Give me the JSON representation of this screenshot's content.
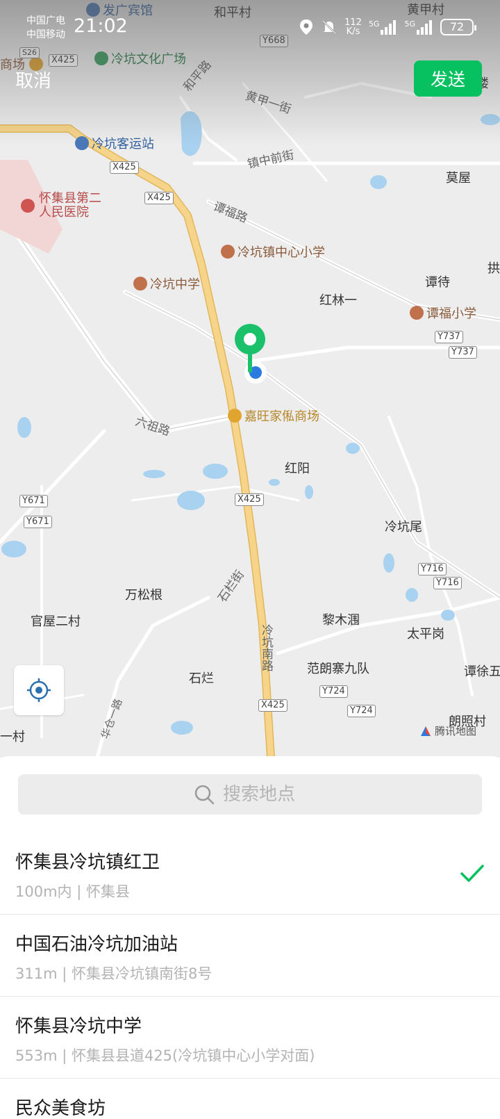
{
  "status_bar": {
    "carrier_line1": "中国广电",
    "carrier_line2": "中国移动",
    "time": "21:02",
    "net_speed_value": "112",
    "net_speed_unit": "K/s",
    "signal1_label": "5G",
    "signal2_label": "5G",
    "battery": "72"
  },
  "header": {
    "cancel_label": "取消",
    "send_label": "发送"
  },
  "map": {
    "provider": "腾讯地图",
    "labels": {
      "fa_guang_hotel": "发广宾馆",
      "he_ping_cun": "和平村",
      "huang_jia_cun": "黄甲村",
      "shang_chang": "商场",
      "leng_keng_culture_square": "冷坑文化广场",
      "lou": "楼",
      "he_ping_lu": "和平路",
      "huang_jia_yi_jie": "黄甲一街",
      "leng_keng_bus_station": "冷坑客运站",
      "zhen_zhong_qian_jie": "镇中前街",
      "mo_wu": "莫屋",
      "hospital_line1": "怀集县第二",
      "hospital_line2": "人民医院",
      "tan_fu_lu": "谭福路",
      "leng_keng_central_primary": "冷坑镇中心小学",
      "leng_keng_middle_school": "冷坑中学",
      "tan_dai": "谭待",
      "gong": "拱",
      "hong_lin_yi": "红林一",
      "tan_fu_primary": "谭福小学",
      "jia_wang_furniture": "嘉旺家俬商场",
      "liu_zu_lu": "六祖路",
      "hong_yang": "红阳",
      "leng_keng_wei": "冷坑尾",
      "wan_song_gen": "万松根",
      "shi_lan_jie": "石栏街",
      "guan_wu_er_cun": "官屋二村",
      "li_mu_wei": "黎木涠",
      "tai_ping_gang": "太平岗",
      "leng_keng_nan_lu": "冷坑南路",
      "fan_lang_zhai": "范朗寨九队",
      "tan_xu_wu": "谭徐五",
      "shi_lan": "石烂",
      "lang_zhao_cun": "朗照村",
      "yi_cun": "一村",
      "hua_lu": "华仓一路"
    },
    "shields": {
      "y668": "Y668",
      "x425_a": "X425",
      "x425_b": "X425",
      "x425_c": "X425",
      "x425_d": "X425",
      "x425_e": "X425",
      "y737_a": "Y737",
      "y737_b": "Y737",
      "y671_a": "Y671",
      "y671_b": "Y671",
      "y716_a": "Y716",
      "y716_b": "Y716",
      "y724_a": "Y724",
      "y724_b": "Y724",
      "s": "S26"
    }
  },
  "search": {
    "placeholder": "搜索地点"
  },
  "results": [
    {
      "name": "怀集县冷坑镇红卫",
      "detail": "100m内 | 怀集县",
      "selected": true
    },
    {
      "name": "中国石油冷坑加油站",
      "detail": "311m | 怀集县冷坑镇南街8号",
      "selected": false
    },
    {
      "name": "怀集县冷坑中学",
      "detail": "553m | 怀集县县道425(冷坑镇中心小学对面)",
      "selected": false
    },
    {
      "name": "民众美食坊",
      "detail": "",
      "selected": false
    }
  ],
  "colors": {
    "accent": "#07c160",
    "pin_green": "#1bc06a",
    "location_blue": "#2a7ae2",
    "highway_yellow": "#f6d48a",
    "water": "#a9d2f0"
  }
}
